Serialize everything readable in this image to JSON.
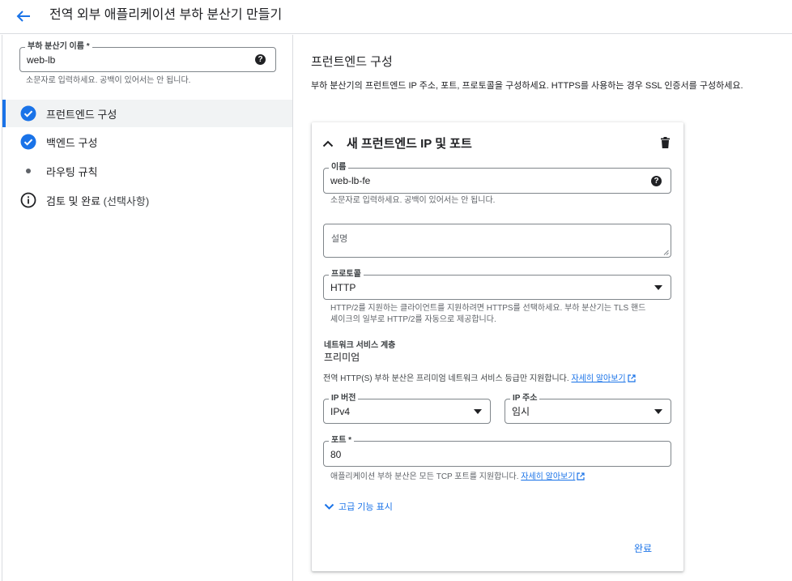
{
  "header": {
    "title": "전역 외부 애플리케이션 부하 분산기 만들기"
  },
  "lb_name": {
    "label": "부하 분산기 이름 *",
    "value": "web-lb",
    "help": "소문자로 입력하세요. 공백이 있어서는 안 됩니다."
  },
  "steps": [
    {
      "label": "프런트엔드 구성",
      "status": "complete",
      "active": true
    },
    {
      "label": "백엔드 구성",
      "status": "complete",
      "active": false
    },
    {
      "label": "라우팅 규칙",
      "status": "pending",
      "active": false
    },
    {
      "label": "검토 및 완료",
      "label_suffix": "(선택사항)",
      "status": "info",
      "active": false
    }
  ],
  "frontend": {
    "title": "프런트엔드 구성",
    "description": "부하 분산기의 프런트엔드 IP 주소, 포트, 프로토콜을 구성하세요. HTTPS를 사용하는 경우 SSL 인증서를 구성하세요.",
    "card": {
      "title": "새 프런트엔드 IP 및 포트",
      "name": {
        "label": "이름",
        "value": "web-lb-fe",
        "help": "소문자로 입력하세요. 공백이 있어서는 안 됩니다."
      },
      "description_field": {
        "placeholder": "설명"
      },
      "protocol": {
        "label": "프로토콜",
        "value": "HTTP",
        "help_line1": "HTTP/2를 지원하는 클라이언트를 지원하려면 HTTPS를 선택하세요. 부하 분산기는 TLS 핸드",
        "help_line2": "셰이크의 일부로 HTTP/2를 자동으로 제공합니다."
      },
      "network_tier": {
        "label": "네트워크 서비스 계층",
        "value": "프리미엄",
        "note": "전역 HTTP(S) 부하 분산은 프리미엄 네트워크 서비스 등급만 지원합니다.",
        "link": "자세히 알아보기"
      },
      "ip_version": {
        "label": "IP 버전",
        "value": "IPv4"
      },
      "ip_address": {
        "label": "IP 주소",
        "value": "임시"
      },
      "port": {
        "label": "포트 *",
        "value": "80",
        "help": "애플리케이션 부하 분산은 모든 TCP 포트를 지원합니다.",
        "link": "자세히 알아보기"
      },
      "advanced_toggle": "고급 기능 표시",
      "done_button": "완료"
    }
  },
  "colors": {
    "accent": "#1a73e8",
    "text": "#202124",
    "muted": "#5f6368",
    "border": "#80868b"
  },
  "icons": [
    "arrow-back-icon",
    "help-icon",
    "check-circle-icon",
    "dot-icon",
    "info-icon",
    "chevron-up-icon",
    "delete-icon",
    "dropdown-arrow-icon",
    "external-link-icon",
    "chevron-down-icon"
  ]
}
